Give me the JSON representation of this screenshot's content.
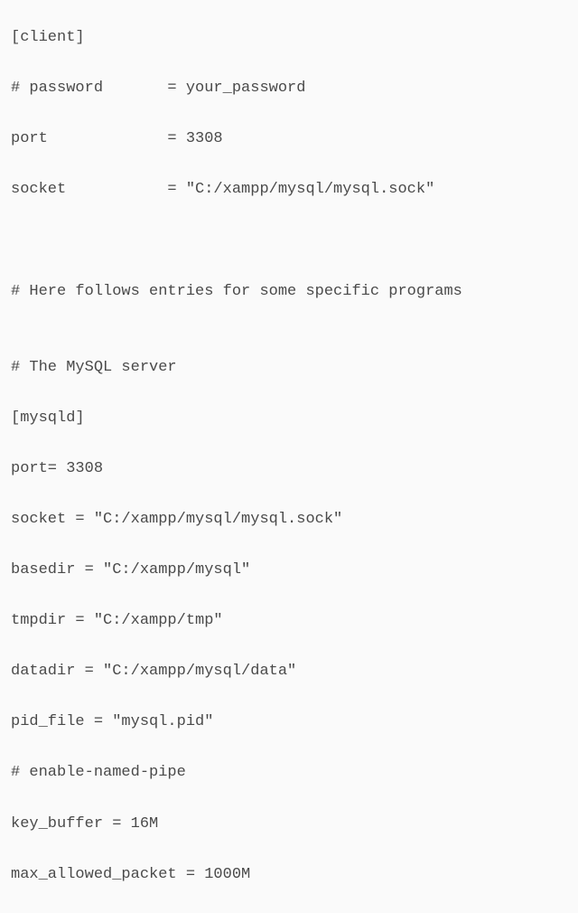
{
  "lines": [
    "[client]",
    "# password       = your_password",
    "port             = 3308",
    "socket           = \"C:/xampp/mysql/mysql.sock\"",
    "",
    "",
    "# Here follows entries for some specific programs",
    "",
    "# The MySQL server",
    "[mysqld]",
    "port= 3308",
    "socket = \"C:/xampp/mysql/mysql.sock\"",
    "basedir = \"C:/xampp/mysql\"",
    "tmpdir = \"C:/xampp/tmp\"",
    "datadir = \"C:/xampp/mysql/data\"",
    "pid_file = \"mysql.pid\"",
    "# enable-named-pipe",
    "key_buffer = 16M",
    "max_allowed_packet = 1000M"
  ]
}
